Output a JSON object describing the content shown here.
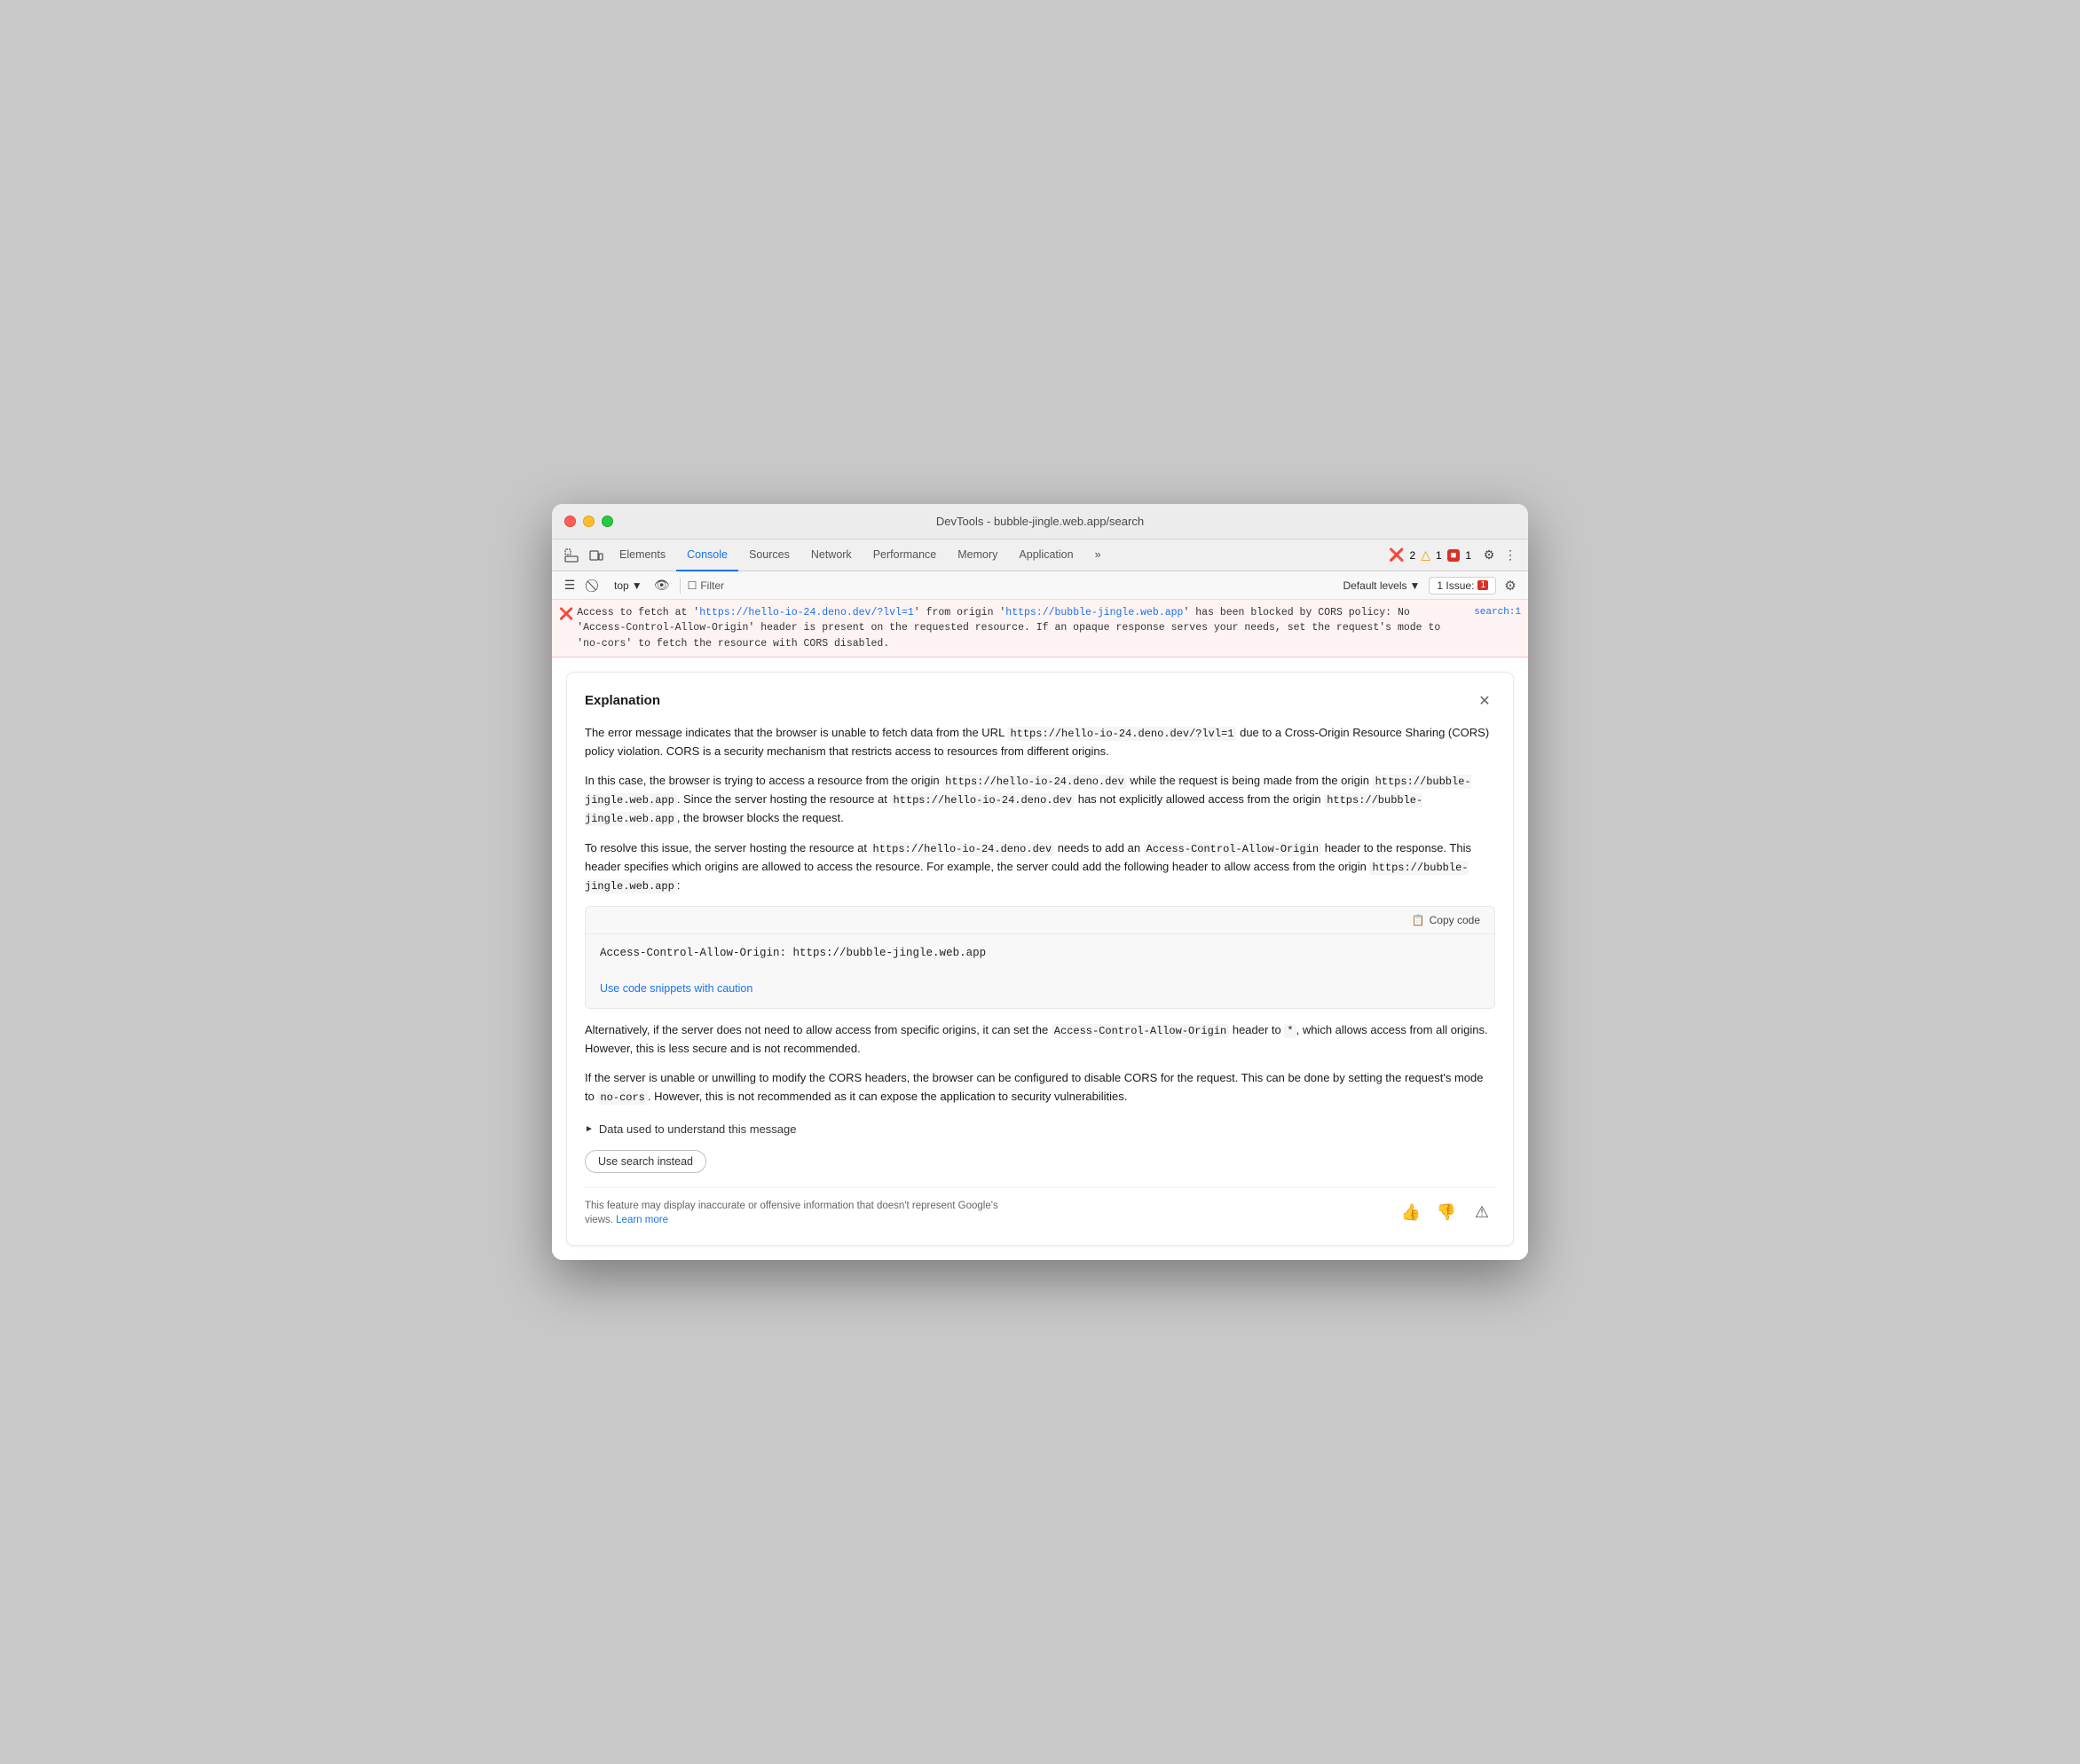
{
  "window": {
    "title": "DevTools - bubble-jingle.web.app/search"
  },
  "tabs": [
    {
      "id": "elements",
      "label": "Elements",
      "active": false
    },
    {
      "id": "console",
      "label": "Console",
      "active": true
    },
    {
      "id": "sources",
      "label": "Sources",
      "active": false
    },
    {
      "id": "network",
      "label": "Network",
      "active": false
    },
    {
      "id": "performance",
      "label": "Performance",
      "active": false
    },
    {
      "id": "memory",
      "label": "Memory",
      "active": false
    },
    {
      "id": "application",
      "label": "Application",
      "active": false
    }
  ],
  "toolbar": {
    "context": "top",
    "filter_placeholder": "Filter",
    "levels_label": "Default levels",
    "issues_label": "1 Issue:",
    "issues_count": "1"
  },
  "error": {
    "text_before": "Access to fetch at '",
    "link1": "https://hello-io-24.deno.dev/?lvl=1",
    "text_middle": "' from origin '",
    "link2": "https://bubble-jingle.web.app",
    "text_after": "' has been blocked by CORS policy: No 'Access-Control-Allow-Origin' header is present on the requested resource. If an opaque response serves your needs, set the request's mode to 'no-cors' to fetch the resource with CORS disabled.",
    "source": "search:1"
  },
  "card": {
    "title": "Explanation",
    "paragraphs": [
      "The error message indicates that the browser is unable to fetch data from the URL https://hello-io-24.deno.dev/?lvl=1 due to a Cross-Origin Resource Sharing (CORS) policy violation. CORS is a security mechanism that restricts access to resources from different origins.",
      "In this case, the browser is trying to access a resource from the origin https://hello-io-24.deno.dev while the request is being made from the origin https://bubble-jingle.web.app. Since the server hosting the resource at https://hello-io-24.deno.dev has not explicitly allowed access from the origin https://bubble-jingle.web.app, the browser blocks the request.",
      "To resolve this issue, the server hosting the resource at https://hello-io-24.deno.dev needs to add an Access-Control-Allow-Origin header to the response. This header specifies which origins are allowed to access the resource. For example, the server could add the following header to allow access from the origin https://bubble-jingle.web.app:"
    ],
    "code_snippet": "Access-Control-Allow-Origin: https://bubble-jingle.web.app",
    "caution_link": "Use code snippets with caution",
    "copy_btn": "Copy code",
    "paragraph_after": "Alternatively, if the server does not need to allow access from specific origins, it can set the Access-Control-Allow-Origin header to *, which allows access from all origins. However, this is less secure and is not recommended.",
    "paragraph_last": "If the server is unable or unwilling to modify the CORS headers, the browser can be configured to disable CORS for the request. This can be done by setting the request's mode to no-cors. However, this is not recommended as it can expose the application to security vulnerabilities.",
    "data_section_label": "Data used to understand this message",
    "use_search_label": "Use search instead",
    "footer_text": "This feature may display inaccurate or offensive information that doesn't represent Google's views.",
    "learn_more": "Learn more"
  }
}
